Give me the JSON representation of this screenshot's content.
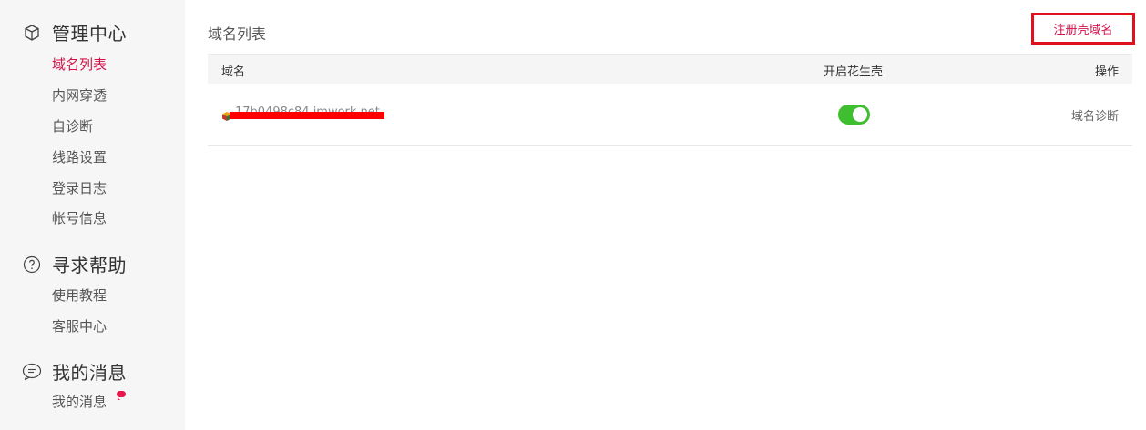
{
  "sidebar": {
    "sections": [
      {
        "icon": "cube-outline-icon",
        "title": "管理中心",
        "items": [
          {
            "label": "域名列表",
            "active": true
          },
          {
            "label": "内网穿透"
          },
          {
            "label": "自诊断"
          },
          {
            "label": "线路设置"
          },
          {
            "label": "登录日志"
          },
          {
            "label": "帐号信息"
          }
        ]
      },
      {
        "icon": "question-circle-icon",
        "title": "寻求帮助",
        "items": [
          {
            "label": "使用教程"
          },
          {
            "label": "客服中心"
          }
        ]
      },
      {
        "icon": "message-bubble-icon",
        "title": "我的消息",
        "items": [
          {
            "label": "我的消息",
            "badge": "unread-dot"
          }
        ]
      }
    ]
  },
  "main": {
    "title": "域名列表",
    "register_button": "注册壳域名",
    "table": {
      "columns": [
        "域名",
        "开启花生壳",
        "操作"
      ],
      "rows": [
        {
          "domain": "17b0498c84.imwork.net",
          "enabled": true,
          "action": "域名诊断"
        }
      ]
    }
  },
  "colors": {
    "accent": "#d2114a",
    "toggle_on": "#3fbf2f",
    "sidebar_bg": "#f6f6f6",
    "highlight_border": "#e0111f",
    "redaction": "#ff0000"
  }
}
